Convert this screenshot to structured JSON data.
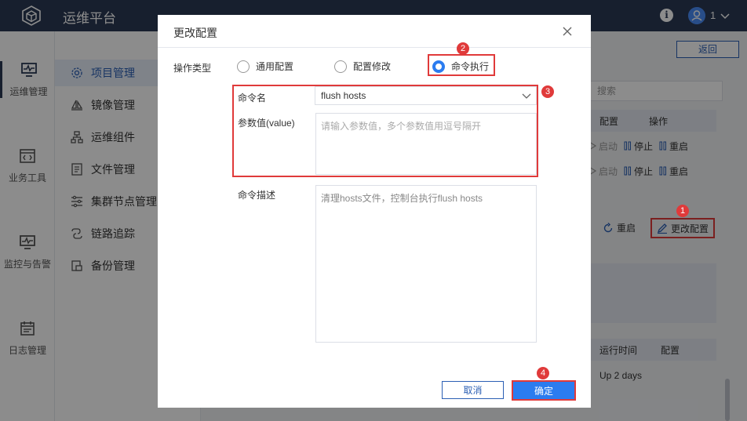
{
  "app": {
    "title": "运维平台",
    "user_count": "1"
  },
  "leftnav": [
    {
      "label": "运维管理",
      "icon": "monitor-icon"
    },
    {
      "label": "业务工具",
      "icon": "code-window-icon"
    },
    {
      "label": "监控与告警",
      "icon": "monitor-pulse-icon"
    },
    {
      "label": "日志管理",
      "icon": "calendar-log-icon"
    }
  ],
  "submenu": [
    {
      "label": "项目管理",
      "icon": "gear-icon"
    },
    {
      "label": "镜像管理",
      "icon": "sail-icon"
    },
    {
      "label": "运维组件",
      "icon": "hierarchy-icon"
    },
    {
      "label": "文件管理",
      "icon": "document-icon"
    },
    {
      "label": "集群节点管理",
      "icon": "sliders-icon"
    },
    {
      "label": "链路追踪",
      "icon": "link-icon"
    },
    {
      "label": "备份管理",
      "icon": "backup-icon"
    }
  ],
  "content": {
    "back_label": "返回",
    "search_placeholder": "搜索",
    "table1_headers": [
      "配置",
      "操作"
    ],
    "row_actions": [
      "启动",
      "停止",
      "重启"
    ],
    "restart_label": "重启",
    "change_config_label": "更改配置",
    "table2_headers": [
      "运行时间",
      "配置"
    ],
    "uptime": "Up 2 days"
  },
  "dialog": {
    "title": "更改配置",
    "op_type_label": "操作类型",
    "radios": [
      {
        "label": "通用配置",
        "checked": false
      },
      {
        "label": "配置修改",
        "checked": false
      },
      {
        "label": "命令执行",
        "checked": true
      }
    ],
    "cmd_name_label": "命令名",
    "cmd_name_value": "flush hosts",
    "param_label": "参数值(value)",
    "param_placeholder": "请输入参数值，多个参数值用逗号隔开",
    "desc_label": "命令描述",
    "desc_value": "清理hosts文件，控制台执行flush hosts",
    "cancel_label": "取消",
    "ok_label": "确定"
  },
  "steps": [
    "1",
    "2",
    "3",
    "4"
  ],
  "colors": {
    "accent": "#2b7cf0",
    "header": "#2b3a55",
    "highlight": "#e03a3a"
  }
}
